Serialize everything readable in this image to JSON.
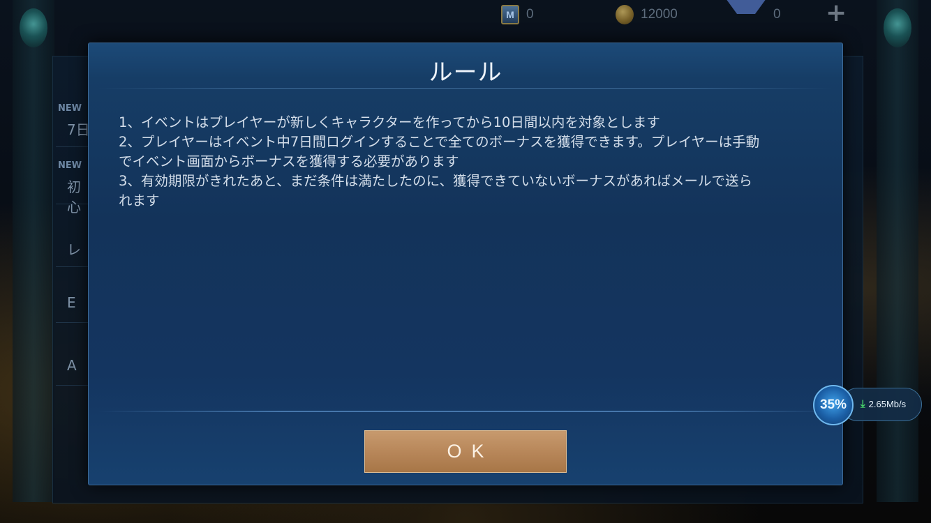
{
  "topbar": {
    "medal_count": "0",
    "gold_count": "12000",
    "diamond_count": "0"
  },
  "background": {
    "tabs": [
      {
        "badge": "NEW",
        "label": "7日"
      },
      {
        "badge": "NEW",
        "label": "初心"
      },
      {
        "badge": "",
        "label": "レ"
      },
      {
        "badge": "",
        "label": "E"
      },
      {
        "badge": "",
        "label": "A"
      }
    ]
  },
  "modal": {
    "title": "ルール",
    "rules": [
      "1、イベントはプレイヤーが新しくキャラクターを作ってから10日間以内を対象とします",
      "2、プレイヤーはイベント中7日間ログインすることで全てのボーナスを獲得できます。プレイヤーは手動\nでイベント画面からボーナスを獲得する必要があります",
      "3、有効期限がきれたあと、まだ条件は満たしたのに、獲得できていないボーナスがあればメールで送ら\nれます"
    ],
    "ok_label": "OK"
  },
  "download": {
    "percent": "35%",
    "speed": "2.65Mb/s"
  }
}
